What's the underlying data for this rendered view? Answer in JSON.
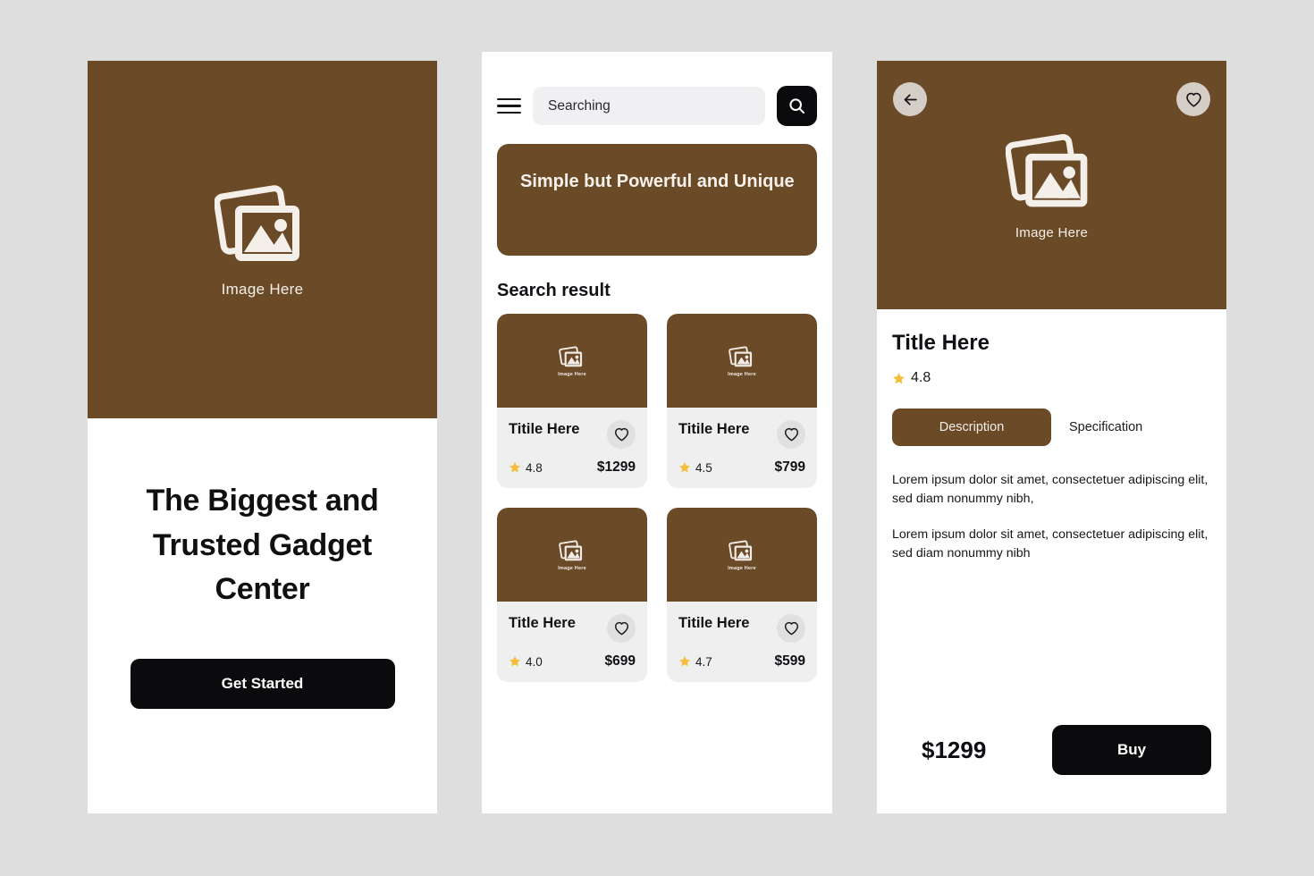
{
  "theme": {
    "brown": "#6b4a28",
    "dark": "#0b0b0e",
    "page_bg": "#dedede",
    "star_gold": "#f5be3a",
    "card_bg": "#efefef"
  },
  "onboarding": {
    "image_placeholder_label": "Image Here",
    "headline": "The Biggest and Trusted Gadget Center",
    "cta_label": "Get Started"
  },
  "search": {
    "menu_icon": "hamburger-icon",
    "search_icon": "search-icon",
    "input_value": "Searching",
    "input_placeholder": "Searching",
    "banner_text": "Simple but Powerful and Unique",
    "section_title": "Search result",
    "products": [
      {
        "image_label": "Image Here",
        "title": "Titile Here",
        "rating": "4.8",
        "price": "$1299",
        "fav_icon": "heart-icon"
      },
      {
        "image_label": "Image Here",
        "title": "Titile Here",
        "rating": "4.5",
        "price": "$799",
        "fav_icon": "heart-icon"
      },
      {
        "image_label": "Image Here",
        "title": "Title Here",
        "rating": "4.0",
        "price": "$699",
        "fav_icon": "heart-icon"
      },
      {
        "image_label": "Image Here",
        "title": "Titile Here",
        "rating": "4.7",
        "price": "$599",
        "fav_icon": "heart-icon"
      }
    ]
  },
  "detail": {
    "back_icon": "arrow-left-icon",
    "fav_icon": "heart-icon",
    "image_placeholder_label": "Image Here",
    "title": "Title Here",
    "rating": "4.8",
    "tabs": [
      {
        "label": "Description",
        "active": true
      },
      {
        "label": "Specification",
        "active": false
      }
    ],
    "paragraphs": [
      "Lorem ipsum dolor sit amet, consectetuer adipiscing elit, sed diam nonummy nibh,",
      "Lorem ipsum dolor sit amet, consectetuer adipiscing elit, sed diam nonummy nibh"
    ],
    "price": "$1299",
    "buy_label": "Buy"
  }
}
